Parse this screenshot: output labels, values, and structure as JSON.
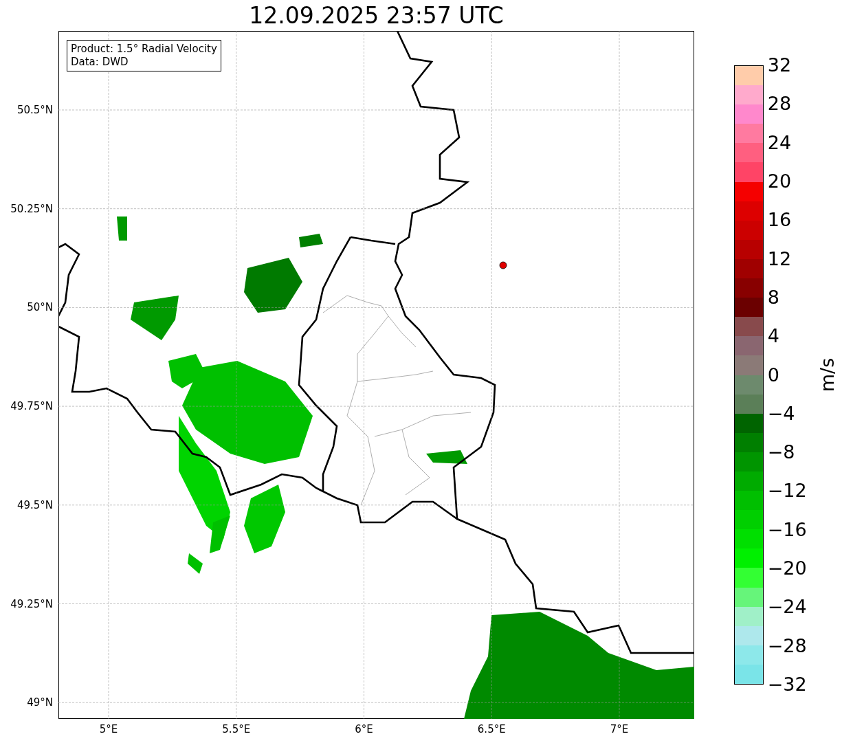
{
  "title": "12.09.2025 23:57 UTC",
  "map": {
    "info_box": [
      "Product: 1.5° Radial Velocity",
      "Data: DWD"
    ],
    "lat_ticks": [
      "50.5°N",
      "50.25°N",
      "50°N",
      "49.75°N",
      "49.5°N",
      "49.25°N",
      "49°N"
    ],
    "lon_ticks": [
      "5°E",
      "5.5°E",
      "6°E",
      "6.5°E",
      "7°E"
    ]
  },
  "colorbar": {
    "label": "m/s",
    "ticks": [
      "32",
      "28",
      "24",
      "20",
      "16",
      "12",
      "8",
      "4",
      "0",
      "−4",
      "−8",
      "−12",
      "−16",
      "−20",
      "−24",
      "−28",
      "−32"
    ],
    "bands": [
      {
        "color": "#ffccaa"
      },
      {
        "color": "#ffaacc"
      },
      {
        "color": "#ff88cc"
      },
      {
        "color": "#ff7aa0"
      },
      {
        "color": "#ff5f80"
      },
      {
        "color": "#ff4466"
      },
      {
        "color": "#f50000"
      },
      {
        "color": "#dd0000"
      },
      {
        "color": "#cc0000"
      },
      {
        "color": "#b80000"
      },
      {
        "color": "#a00000"
      },
      {
        "color": "#880000"
      },
      {
        "color": "#6b0000"
      },
      {
        "color": "#884a4c"
      },
      {
        "color": "#8a6670"
      },
      {
        "color": "#8b7a77"
      },
      {
        "color": "#6d8a6d"
      },
      {
        "color": "#5b7f58"
      },
      {
        "color": "#006400"
      },
      {
        "color": "#007f00"
      },
      {
        "color": "#009500"
      },
      {
        "color": "#00ab00"
      },
      {
        "color": "#00bf00"
      },
      {
        "color": "#00cf00"
      },
      {
        "color": "#00df00"
      },
      {
        "color": "#00f000"
      },
      {
        "color": "#33ff33"
      },
      {
        "color": "#66f57a"
      },
      {
        "color": "#a0f0c8"
      },
      {
        "color": "#aee8ec"
      },
      {
        "color": "#8de8ea"
      },
      {
        "color": "#7ae4e8"
      }
    ]
  }
}
